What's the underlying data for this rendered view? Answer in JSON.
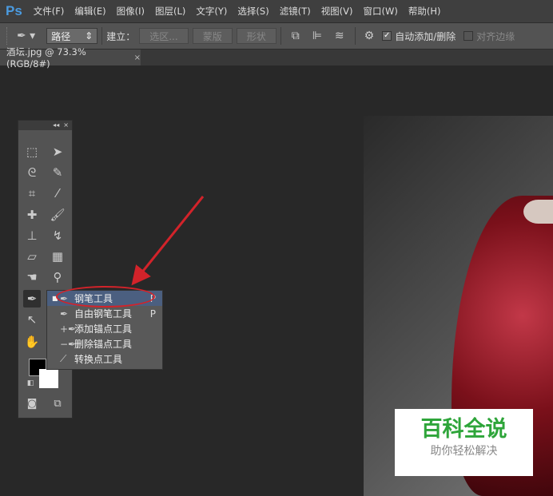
{
  "app": {
    "logo": "Ps"
  },
  "menu": [
    "文件(F)",
    "编辑(E)",
    "图像(I)",
    "图层(L)",
    "文字(Y)",
    "选择(S)",
    "滤镜(T)",
    "视图(V)",
    "窗口(W)",
    "帮助(H)"
  ],
  "options": {
    "mode": "路径",
    "make_label": "建立：",
    "selection": "选区...",
    "mask": "蒙版",
    "shape": "形状",
    "auto_add_delete": "自动添加/删除",
    "align_edges": "对齐边缘",
    "auto_checked": true,
    "align_checked": false
  },
  "document_tab": {
    "title": "酒坛.jpg @ 73.3%(RGB/8#)",
    "close": "×"
  },
  "toolbox": {
    "collapse": "◂◂",
    "close": "×"
  },
  "flyout": [
    {
      "label": "钢笔工具",
      "key": "P",
      "selected": true
    },
    {
      "label": "自由钢笔工具",
      "key": "P"
    },
    {
      "label": "添加锚点工具",
      "key": ""
    },
    {
      "label": "删除锚点工具",
      "key": ""
    },
    {
      "label": "转换点工具",
      "key": ""
    }
  ],
  "watermark": {
    "title": "百科全说",
    "subtitle": "助你轻松解决"
  },
  "colors": {
    "accent": "#d2232a",
    "selected": "#4b5f80"
  }
}
